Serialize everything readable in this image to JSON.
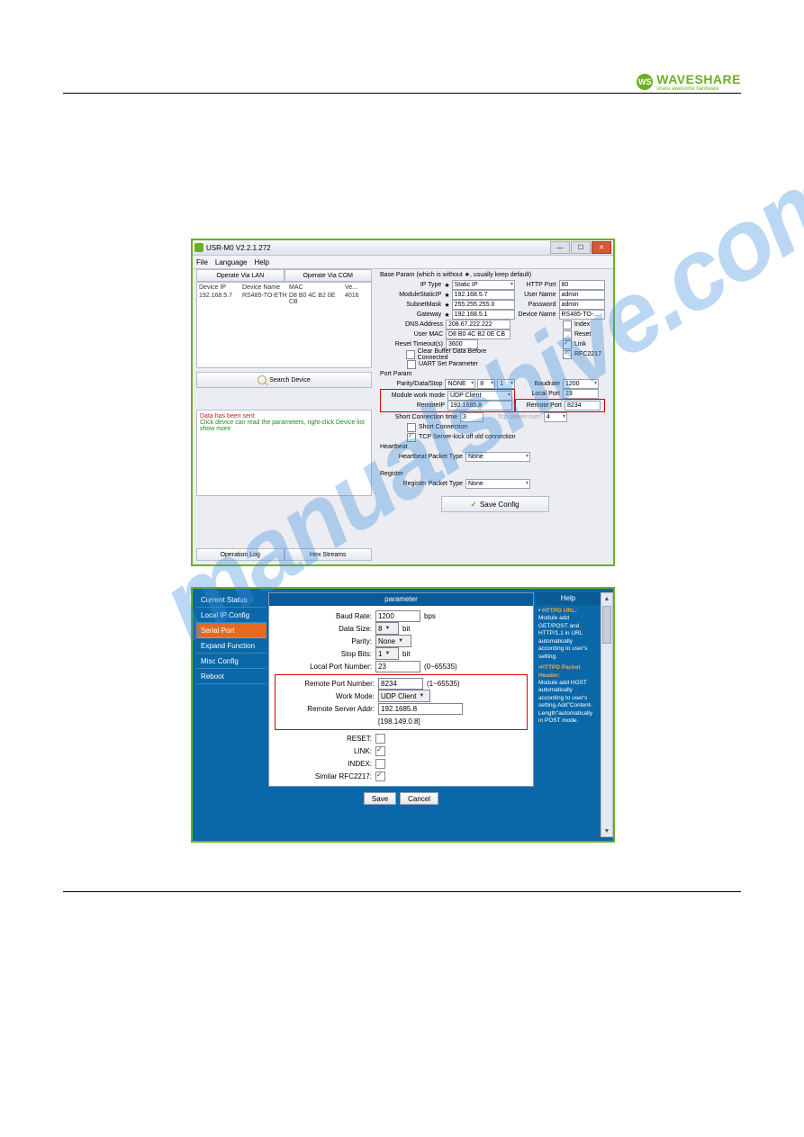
{
  "brand": {
    "name": "WAVESHARE",
    "tagline": "share awesome hardware",
    "logo_initials": "WS"
  },
  "watermark": "manualshive.com",
  "app1": {
    "title": "USR-M0 V2.2.1.272",
    "menu": [
      "File",
      "Language",
      "Help"
    ],
    "tabs": {
      "lan": "Operate Via LAN",
      "com": "Operate Via COM"
    },
    "device_table": {
      "headers": [
        "Device IP",
        "Device Name",
        "MAC",
        "Ve..."
      ],
      "row": [
        "192.168.5.7",
        "RS485-TO-ETH",
        "D8 B0 4C B2 0E CB",
        "4016"
      ]
    },
    "search_button": "Search Device",
    "msg": {
      "line1": "Data has been sent",
      "line2": "Click device can read the parameters, right-click Device list show more"
    },
    "op_log": "Operation Log",
    "hex_streams": "Hex Streams",
    "base_param_title": "Base Param (which is without ★, usually keep default)",
    "fields": {
      "ip_type": {
        "label": "IP Type",
        "value": "Static IP"
      },
      "module_static_ip": {
        "label": "ModuleStaticIP",
        "value": "192.168.5.7"
      },
      "subnet_mask": {
        "label": "SubnetMask",
        "value": "255.255.255.0"
      },
      "gateway": {
        "label": "Gateway",
        "value": "192.168.5.1"
      },
      "dns_address": {
        "label": "DNS Address",
        "value": "208.67.222.222"
      },
      "user_mac": {
        "label": "User MAC",
        "value": "D8 B0 4C B2 0E CB"
      },
      "reset_timeout": {
        "label": "Reset Timeout(s)",
        "value": "3600"
      },
      "http_port": {
        "label": "HTTP Port",
        "value": "80"
      },
      "user_name": {
        "label": "User Name",
        "value": "admin"
      },
      "password": {
        "label": "Password",
        "value": "admin"
      },
      "device_name": {
        "label": "Device Name",
        "value": "RS485-TO-..."
      },
      "clear_buffer": "Clear Buffer Data Before Connected",
      "uart_set": "UART Set Parameter",
      "index": "Index",
      "reset": "Reset",
      "link": "Link",
      "rfc": "RFC2217"
    },
    "port_param_title": "Port Param",
    "port": {
      "parity": {
        "label": "Parity/Data/Stop",
        "v1": "NONE",
        "v2": "8",
        "v3": "1"
      },
      "baudrate": {
        "label": "Baudrate",
        "value": "1200"
      },
      "work_mode": {
        "label": "Module work mode",
        "value": "UDP Client"
      },
      "local_port": {
        "label": "Local Port",
        "value": "23"
      },
      "remote_ip": {
        "label": "RemoteIP",
        "value": "192.1685.8"
      },
      "remote_port": {
        "label": "Remote Port",
        "value": "8234"
      },
      "short_conn_time": {
        "label": "Short Connection time",
        "value": "3"
      },
      "tcp_num": {
        "label": "Tcp server-num",
        "value": "4"
      },
      "short_conn": "Short Connection",
      "tcp_kick": "TCP Server-kick off old connection"
    },
    "heartbeat": {
      "title": "Heartbeat",
      "label": "Heartbeat Packet Type",
      "value": "None"
    },
    "register": {
      "title": "Register",
      "label": "Register Packet Type",
      "value": "None"
    },
    "save": "Save Config"
  },
  "app2": {
    "sidebar": {
      "current_status": "Current Status",
      "local_ip": "Local IP Config",
      "serial_port": "Serial Port",
      "expand": "Expand Function",
      "misc": "Misc Config",
      "reboot": "Reboot"
    },
    "panel_title": "parameter",
    "rows": {
      "baud": {
        "label": "Baud Rate:",
        "value": "1200",
        "unit": "bps"
      },
      "data_size": {
        "label": "Data Size:",
        "value": "8",
        "unit": "bit"
      },
      "parity": {
        "label": "Parity:",
        "value": "None"
      },
      "stop_bits": {
        "label": "Stop Bits:",
        "value": "1",
        "unit": "bit"
      },
      "local_port": {
        "label": "Local Port Number:",
        "value": "23",
        "hint": "(0~65535)"
      },
      "remote_port": {
        "label": "Remote Port Number:",
        "value": "8234",
        "hint": "(1~65535)"
      },
      "work_mode": {
        "label": "Work Mode:",
        "value": "UDP Client"
      },
      "remote_addr": {
        "label": "Remote Server Addr:",
        "value": "192.1685.8",
        "sub": "[198.149.0.8]"
      },
      "reset": {
        "label": "RESET:"
      },
      "link": {
        "label": "LINK:"
      },
      "index": {
        "label": "INDEX:"
      },
      "rfc": {
        "label": "Similar RFC2217:"
      }
    },
    "buttons": {
      "save": "Save",
      "cancel": "Cancel"
    },
    "help": {
      "title": "Help",
      "bullet1_title": "HTTPD URL:",
      "bullet1_body": "Module add GET/POST and HTTP/1.1 in URL automatically according to user's setting.",
      "bullet2_title": "•HTTPD Packet Header:",
      "bullet2_body": "Module add HOST automatically according to user's setting.Add\"Content-Length\"automatically in POST mode."
    }
  }
}
